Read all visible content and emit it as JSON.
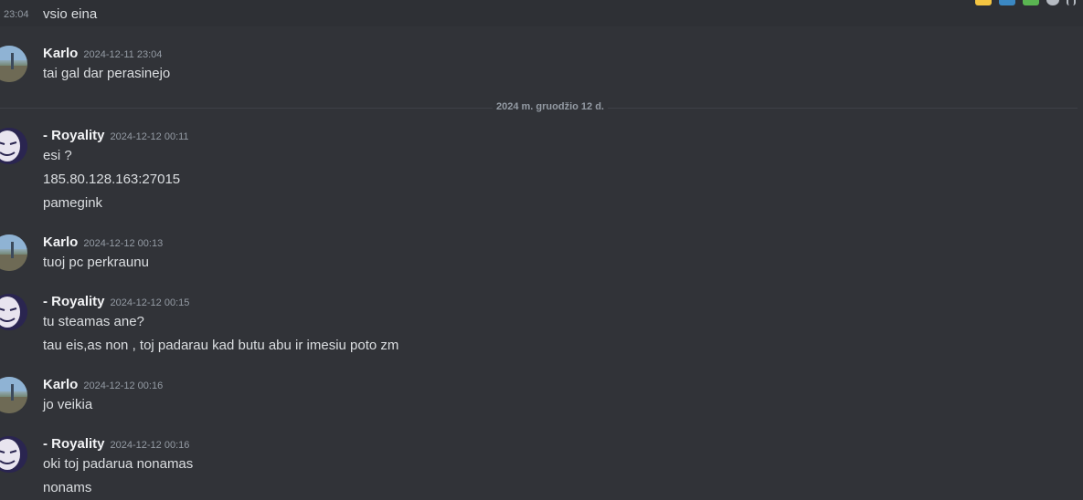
{
  "top": {
    "time": "23:04",
    "text": "vsio eina"
  },
  "toolbar": {
    "icons": [
      "thumbs-up-icon",
      "reaction-icon",
      "check-icon",
      "add-reaction-icon",
      "more-icon"
    ],
    "colors": [
      "#f4c542",
      "#3b88c3",
      "#5ab552",
      "#b5bac1",
      "#b5bac1"
    ]
  },
  "divider": {
    "label": "2024 m. gruodžio 12 d."
  },
  "groups": [
    {
      "author": "Karlo",
      "timestamp": "2024-12-11 23:04",
      "lines": [
        "tai gal dar perasinejo"
      ]
    },
    {
      "author": "- Royality",
      "timestamp": "2024-12-12 00:11",
      "lines": [
        "esi ?",
        "185.80.128.163:27015",
        "pamegink"
      ]
    },
    {
      "author": "Karlo",
      "timestamp": "2024-12-12 00:13",
      "lines": [
        "tuoj pc perkraunu"
      ]
    },
    {
      "author": "- Royality",
      "timestamp": "2024-12-12 00:15",
      "lines": [
        "tu steamas ane?",
        "tau eis,as non , toj padarau kad butu abu ir imesiu poto zm"
      ]
    },
    {
      "author": "Karlo",
      "timestamp": "2024-12-12 00:16",
      "lines": [
        "jo veikia"
      ]
    },
    {
      "author": "- Royality",
      "timestamp": "2024-12-12 00:16",
      "lines": [
        "oki toj padarua nonamas",
        "nonams"
      ]
    }
  ],
  "colors": {
    "background": "#313338",
    "hover": "#2e3035",
    "author": "#f2f3f5",
    "muted": "#949ba4"
  }
}
